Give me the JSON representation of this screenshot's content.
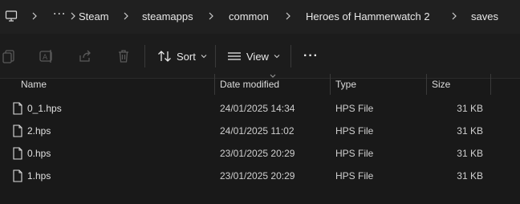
{
  "address": {
    "more_label": "···",
    "crumbs": [
      "Steam",
      "steamapps",
      "common",
      "Heroes of Hammerwatch 2",
      "saves"
    ]
  },
  "toolbar": {
    "sort_label": "Sort",
    "view_label": "View",
    "more_label": "···"
  },
  "columns": {
    "name": "Name",
    "date": "Date modified",
    "type": "Type",
    "size": "Size"
  },
  "files": [
    {
      "name": "0_1.hps",
      "date": "24/01/2025 14:34",
      "type": "HPS File",
      "size": "31 KB"
    },
    {
      "name": "2.hps",
      "date": "24/01/2025 11:02",
      "type": "HPS File",
      "size": "31 KB"
    },
    {
      "name": "0.hps",
      "date": "23/01/2025 20:29",
      "type": "HPS File",
      "size": "31 KB"
    },
    {
      "name": "1.hps",
      "date": "23/01/2025 20:29",
      "type": "HPS File",
      "size": "31 KB"
    }
  ],
  "icons": {
    "pc": "this-pc-icon",
    "file": "file-icon",
    "copy": "copy-icon",
    "rename": "rename-icon",
    "share": "share-icon",
    "delete": "trash-icon",
    "sort": "sort-icon",
    "view": "view-icon"
  },
  "colors": {
    "background": "#191919",
    "addressbar": "#202020",
    "text": "#e0e0e0"
  }
}
